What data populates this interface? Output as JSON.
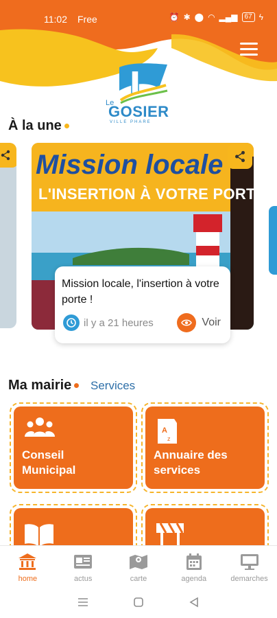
{
  "status_bar": {
    "time": "11:02",
    "carrier": "Free",
    "battery": "67"
  },
  "header": {
    "logo_text": "GOSIER",
    "logo_prefix": "Le",
    "logo_sub": "VILLE PHARE"
  },
  "a_la_une": {
    "title": "À la une",
    "card": {
      "banner_title": "Mission locale",
      "banner_sub": "L'INSERTION À VOTRE PORTE <",
      "title": "Mission locale, l'insertion à votre porte !",
      "time": "il y a 21 heures",
      "see_label": "Voir"
    }
  },
  "mairie": {
    "title": "Ma mairie",
    "services_link": "Services",
    "tiles": [
      {
        "label": "Conseil Municipal",
        "icon": "people-icon"
      },
      {
        "label": "Annuaire des services",
        "icon": "directory-icon"
      },
      {
        "label": "",
        "icon": "book-icon"
      },
      {
        "label": "",
        "icon": "barrier-icon"
      }
    ]
  },
  "bottom_nav": [
    {
      "label": "home",
      "icon": "bank-icon",
      "active": true
    },
    {
      "label": "actus",
      "icon": "newspaper-icon",
      "active": false
    },
    {
      "label": "carte",
      "icon": "map-icon",
      "active": false
    },
    {
      "label": "agenda",
      "icon": "calendar-icon",
      "active": false
    },
    {
      "label": "demarches",
      "icon": "monitor-icon",
      "active": false
    }
  ],
  "colors": {
    "orange": "#ee6d1c",
    "yellow": "#f7b61d",
    "blue": "#2f9bd6"
  }
}
